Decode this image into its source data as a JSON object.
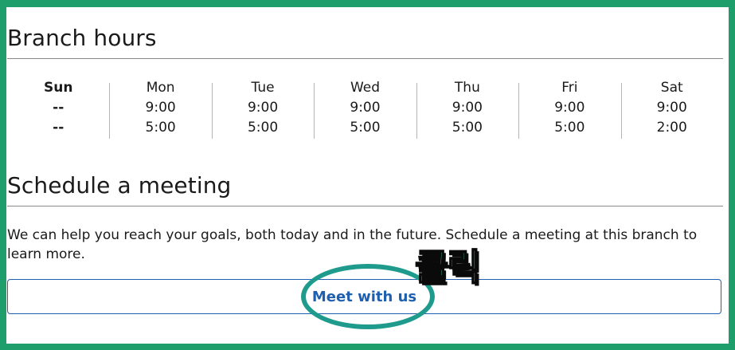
{
  "hours_section": {
    "title": "Branch hours",
    "days": [
      {
        "name": "Sun",
        "open": "--",
        "close": "--"
      },
      {
        "name": "Mon",
        "open": "9:00",
        "close": "5:00"
      },
      {
        "name": "Tue",
        "open": "9:00",
        "close": "5:00"
      },
      {
        "name": "Wed",
        "open": "9:00",
        "close": "5:00"
      },
      {
        "name": "Thu",
        "open": "9:00",
        "close": "5:00"
      },
      {
        "name": "Fri",
        "open": "9:00",
        "close": "5:00"
      },
      {
        "name": "Sat",
        "open": "9:00",
        "close": "2:00"
      }
    ]
  },
  "meeting_section": {
    "title": "Schedule a meeting",
    "description": "We can help you reach your goals, both today and in the future. Schedule a meeting at this branch to learn more.",
    "button_label": "Meet with us"
  },
  "annotation": {
    "label": "클릭",
    "ellipse_color": "#1e9b8c",
    "label_color": "#3fe0a6"
  },
  "colors": {
    "frame": "#1d9e6a",
    "link": "#1f5fb0"
  }
}
